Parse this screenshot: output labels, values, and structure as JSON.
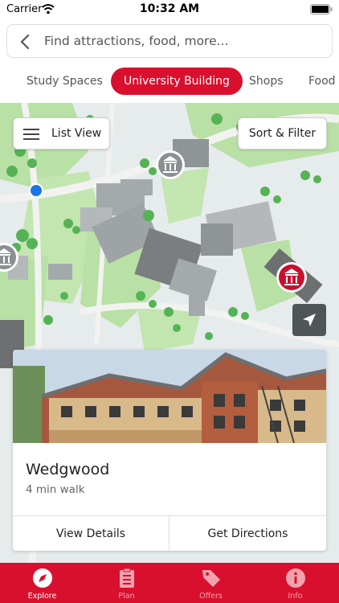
{
  "status_bar": {
    "carrier": "Carrier",
    "time": "10:32 AM"
  },
  "search": {
    "placeholder": "Find attractions, food, more..."
  },
  "categories": [
    {
      "label": "Study Spaces",
      "active": false
    },
    {
      "label": "University Building",
      "active": true
    },
    {
      "label": "Shops",
      "active": false
    },
    {
      "label": "Food",
      "active": false
    }
  ],
  "map": {
    "list_view_label": "List View",
    "sort_filter_label": "Sort & Filter",
    "colors": {
      "grass": "#b9e0a5",
      "path": "#eef1ee",
      "building": "#a4a9ab",
      "building_dark": "#6d6f70",
      "tree": "#55b356",
      "pin_red": "#c8102e",
      "pin_grey": "#8a8f91",
      "location": "#1a73e8"
    }
  },
  "selected_place": {
    "name": "Wedgwood",
    "distance": "4 min walk",
    "view_details_label": "View Details",
    "directions_label": "Get Directions"
  },
  "tabbar": [
    {
      "label": "Explore",
      "icon": "compass-icon",
      "active": true
    },
    {
      "label": "Plan",
      "icon": "clipboard-icon",
      "active": false
    },
    {
      "label": "Offers",
      "icon": "tag-icon",
      "active": false
    },
    {
      "label": "Info",
      "icon": "info-icon",
      "active": false
    }
  ],
  "accent_color": "#d8102e"
}
